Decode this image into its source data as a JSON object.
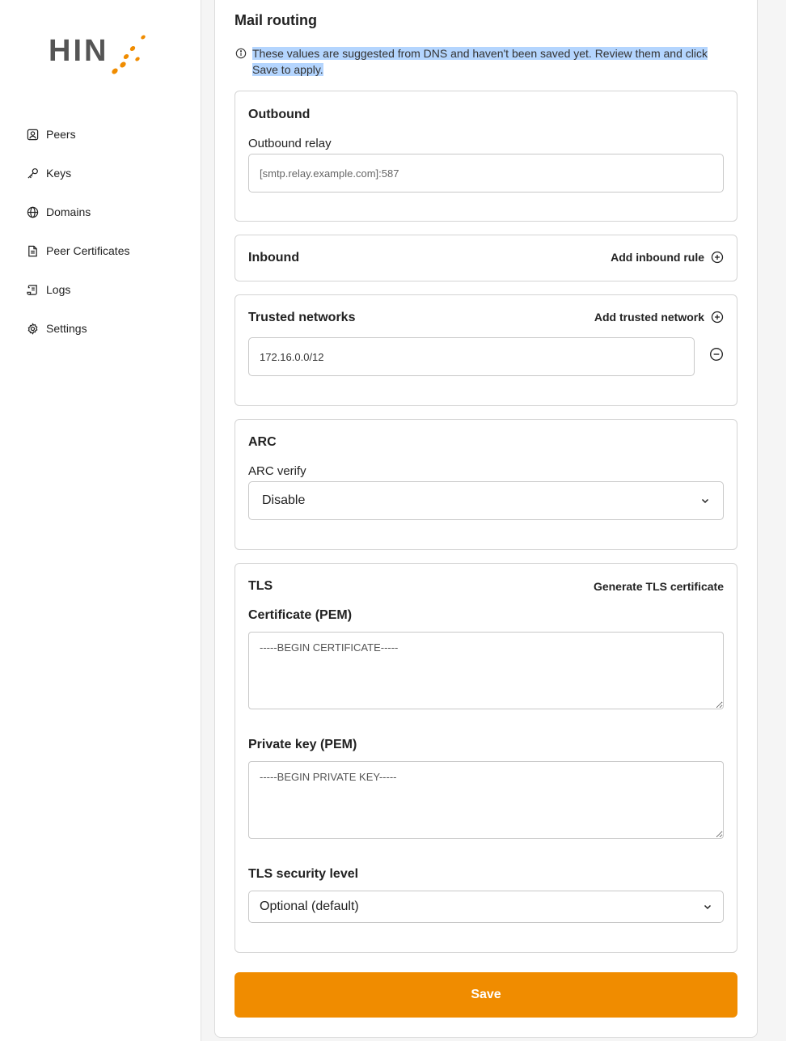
{
  "brand": {
    "logo_text": "HIN",
    "accent": "#f08c00"
  },
  "sidebar": {
    "items": [
      {
        "label": "Peers",
        "icon": "user-square-icon"
      },
      {
        "label": "Keys",
        "icon": "key-icon"
      },
      {
        "label": "Domains",
        "icon": "globe-icon"
      },
      {
        "label": "Peer Certificates",
        "icon": "document-icon"
      },
      {
        "label": "Logs",
        "icon": "scroll-icon"
      },
      {
        "label": "Settings",
        "icon": "gear-icon"
      }
    ]
  },
  "main": {
    "title": "Mail routing",
    "notice": "These values are suggested from DNS and haven't been saved yet. Review them and click Save to apply.",
    "outbound": {
      "title": "Outbound",
      "relay_label": "Outbound relay",
      "relay_placeholder": "[smtp.relay.example.com]:587"
    },
    "inbound": {
      "title": "Inbound",
      "add_label": "Add inbound rule"
    },
    "trusted": {
      "title": "Trusted networks",
      "add_label": "Add trusted network",
      "networks": [
        "172.16.0.0/12"
      ]
    },
    "arc": {
      "title": "ARC",
      "verify_label": "ARC verify",
      "verify_value": "Disable"
    },
    "tls": {
      "title": "TLS",
      "generate_label": "Generate TLS certificate",
      "cert_label": "Certificate (PEM)",
      "cert_placeholder": "-----BEGIN CERTIFICATE-----",
      "key_label": "Private key (PEM)",
      "key_placeholder": "-----BEGIN PRIVATE KEY-----",
      "level_label": "TLS security level",
      "level_value": "Optional (default)"
    },
    "save_label": "Save"
  }
}
